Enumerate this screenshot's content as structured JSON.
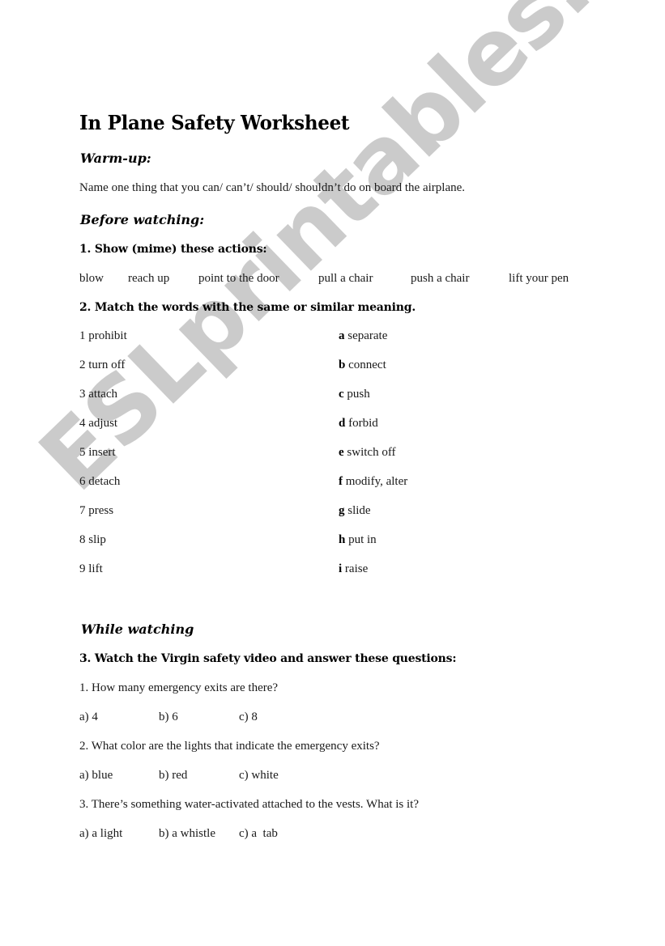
{
  "watermark": "ESLprintables.com",
  "title": "In Plane Safety Worksheet",
  "warmup": {
    "heading": "Warm-up:",
    "text": "Name one thing that you can/ can’t/ should/ shouldn’t do on board the airplane."
  },
  "before_watching": {
    "heading": "Before watching:",
    "exercise1": {
      "instruction": "1. Show (mime) these actions:",
      "actions": [
        "blow",
        "reach up",
        "point to the door",
        "pull a chair",
        "push a chair",
        "lift your pen"
      ]
    },
    "exercise2": {
      "instruction": "2. Match the words with the same or similar meaning.",
      "left": [
        "1 prohibit",
        "2 turn off",
        "3 attach",
        "4 adjust",
        "5 insert",
        "6 detach",
        "7 press",
        "8 slip",
        "9 lift"
      ],
      "right": [
        {
          "letter": "a",
          "text": "separate"
        },
        {
          "letter": "b",
          "text": "connect"
        },
        {
          "letter": "c",
          "text": "push"
        },
        {
          "letter": "d",
          "text": "forbid"
        },
        {
          "letter": "e",
          "text": "switch off"
        },
        {
          "letter": "f",
          "text": "modify, alter"
        },
        {
          "letter": "g",
          "text": "slide"
        },
        {
          "letter": "h",
          "text": "put in"
        },
        {
          "letter": "i",
          "text": "raise"
        }
      ]
    }
  },
  "while_watching": {
    "heading": "While watching",
    "exercise3": {
      "instruction": "3. Watch the Virgin safety video and answer these questions:",
      "questions": [
        {
          "question": "1. How many emergency exits are there?",
          "options": [
            "a) 4",
            "b) 6",
            "c) 8"
          ]
        },
        {
          "question": "2. What color are the lights that indicate the emergency exits?",
          "options": [
            "a) blue",
            "b) red",
            "c) white"
          ]
        },
        {
          "question": "3. There’s something water-activated attached to the vests. What is it?",
          "options": [
            "a) a light",
            "b) a whistle",
            "c) a  tab"
          ]
        }
      ]
    }
  }
}
